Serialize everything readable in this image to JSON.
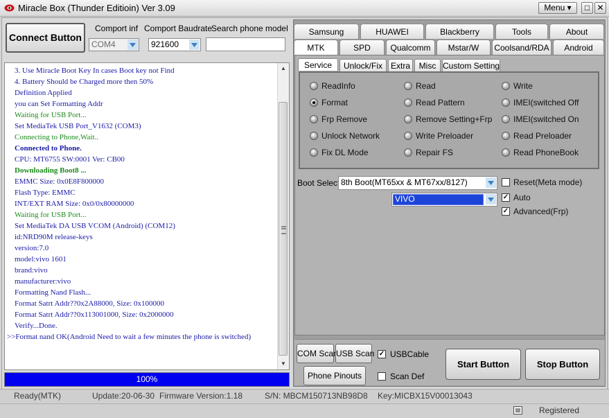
{
  "window": {
    "title": "Miracle Box (Thunder Editioin) Ver 3.09",
    "menu_label": "Menu ▾",
    "minimize_glyph": "□",
    "close_glyph": "✕",
    "app_icon": "red-eye-logo-icon"
  },
  "connect": {
    "button_label": "Connect Button",
    "comport_label": "Comport inf",
    "comport_value": "COM4",
    "baud_label": "Comport Baudrate",
    "baud_value": "921600",
    "search_label": "Search phone model",
    "search_value": ""
  },
  "log": {
    "lines": [
      {
        "text": "3.  Use Miracle Boot Key In cases Boot key not Find",
        "color": "#1a1aa8",
        "bold": false
      },
      {
        "text": "4.  Battery Should be Charged more then 50%",
        "color": "#1a1aa8",
        "bold": false
      },
      {
        "text": "Definition Applied",
        "color": "#1a1aa8",
        "bold": false
      },
      {
        "text": "you can Set Formatting Addr",
        "color": "#1a1aa8",
        "bold": false
      },
      {
        "text": "Waiting for USB Port...",
        "color": "#1c8a1c",
        "bold": false
      },
      {
        "text": "Set MediaTek USB Port_V1632 (COM3)",
        "color": "#1a1aa8",
        "bold": false
      },
      {
        "text": "Connecting to Phone,Wait..",
        "color": "#1c8a1c",
        "bold": false
      },
      {
        "text": "Connected to Phone.",
        "color": "#1a1aa8",
        "bold": true
      },
      {
        "text": "CPU: MT6755 SW:0001 Ver: CB00",
        "color": "#1a1aa8",
        "bold": false
      },
      {
        "text": "Downloading Boot8 ...",
        "color": "#1c8a1c",
        "bold": true
      },
      {
        "text": "EMMC Size: 0x0E8F800000",
        "color": "#1a1aa8",
        "bold": false
      },
      {
        "text": "Flash Type: EMMC",
        "color": "#1a1aa8",
        "bold": false
      },
      {
        "text": "INT/EXT RAM  Size: 0x0/0x80000000",
        "color": "#1a1aa8",
        "bold": false
      },
      {
        "text": "Waiting for USB Port...",
        "color": "#1c8a1c",
        "bold": false
      },
      {
        "text": "Set MediaTek DA USB VCOM (Android) (COM12)",
        "color": "#1a1aa8",
        "bold": false
      },
      {
        "text": "id:NRD90M release-keys",
        "color": "#1a1aa8",
        "bold": false
      },
      {
        "text": "version:7.0",
        "color": "#1a1aa8",
        "bold": false
      },
      {
        "text": "model:vivo 1601",
        "color": "#1a1aa8",
        "bold": false
      },
      {
        "text": "brand:vivo",
        "color": "#1a1aa8",
        "bold": false
      },
      {
        "text": "manufacturer:vivo",
        "color": "#1a1aa8",
        "bold": false
      },
      {
        "text": "Formatting Nand Flash...",
        "color": "#1a1aa8",
        "bold": false
      },
      {
        "text": "Format Satrt Addr??0x2A88000, Size: 0x100000",
        "color": "#1a1aa8",
        "bold": false
      },
      {
        "text": "Format Satrt Addr??0x113001000, Size: 0x2000000",
        "color": "#1a1aa8",
        "bold": false
      },
      {
        "text": "Verify...Done.",
        "color": "#1a1aa8",
        "bold": false
      },
      {
        "text": ">>Format nand OK(Android Need to wait a few minutes the phone is switched)",
        "color": "#1a1aa8",
        "bold": false,
        "wrap": true
      }
    ],
    "scroll_up_glyph": "▲",
    "scroll_down_glyph": "▼"
  },
  "progress": {
    "label": "100%",
    "value": 1.0
  },
  "statusbar": {
    "state": "Ready(MTK)",
    "update": "Update:20-06-30",
    "firmware": "Firmware Version:1.18",
    "serial": "S/N: MBCM150713NB98D8",
    "key": "Key:MICBX15V00013043",
    "registered": "Registered"
  },
  "brand_tabs_row1": [
    "Samsung",
    "HUAWEI",
    "Blackberry",
    "Tools",
    "About"
  ],
  "brand_tabs_row2": [
    "MTK",
    "SPD",
    "Qualcomm",
    "Mstar/W",
    "Coolsand/RDA",
    "Android"
  ],
  "active_brand_tab": "MTK",
  "sub_tabs": [
    "Service",
    "Unlock/Fix",
    "Extra",
    "Misc",
    "Custom Setting"
  ],
  "active_sub_tab": "Service",
  "service_options": [
    {
      "label": "ReadInfo",
      "selected": false
    },
    {
      "label": "Read",
      "selected": false
    },
    {
      "label": "Write",
      "selected": false
    },
    {
      "label": "Format",
      "selected": true
    },
    {
      "label": "Read Pattern",
      "selected": false
    },
    {
      "label": "IMEI(switched Off",
      "selected": false
    },
    {
      "label": "Frp Remove",
      "selected": false
    },
    {
      "label": "Remove Setting+Frp",
      "selected": false
    },
    {
      "label": "IMEI(switched On",
      "selected": false
    },
    {
      "label": "Unlock Network",
      "selected": false
    },
    {
      "label": "Write Preloader",
      "selected": false
    },
    {
      "label": "Read Preloader",
      "selected": false
    },
    {
      "label": "Fix DL Mode",
      "selected": false
    },
    {
      "label": "Repair FS",
      "selected": false
    },
    {
      "label": "Read PhoneBook",
      "selected": false
    }
  ],
  "boot": {
    "label": "Boot Select:",
    "value": "8th Boot(MT65xx & MT67xx/8127)",
    "model_value": "VIVO"
  },
  "right_checks": [
    {
      "label": "Reset(Meta mode)",
      "checked": false
    },
    {
      "label": "Auto",
      "checked": true
    },
    {
      "label": "Advanced(Frp)",
      "checked": true
    }
  ],
  "bottom_controls": {
    "com_scan": "COM Scan",
    "usb_scan": "USB Scan",
    "usb_cable": "USBCable",
    "usb_cable_checked": true,
    "phone_pinouts": "Phone Pinouts",
    "scan_def": "Scan Def",
    "scan_def_checked": false,
    "start": "Start Button",
    "stop": "Stop Button"
  },
  "colors": {
    "accent": "#0000f0",
    "log_blue": "#1a1aa8",
    "log_green": "#1c8a1c",
    "model_select": "#1c44d8"
  }
}
